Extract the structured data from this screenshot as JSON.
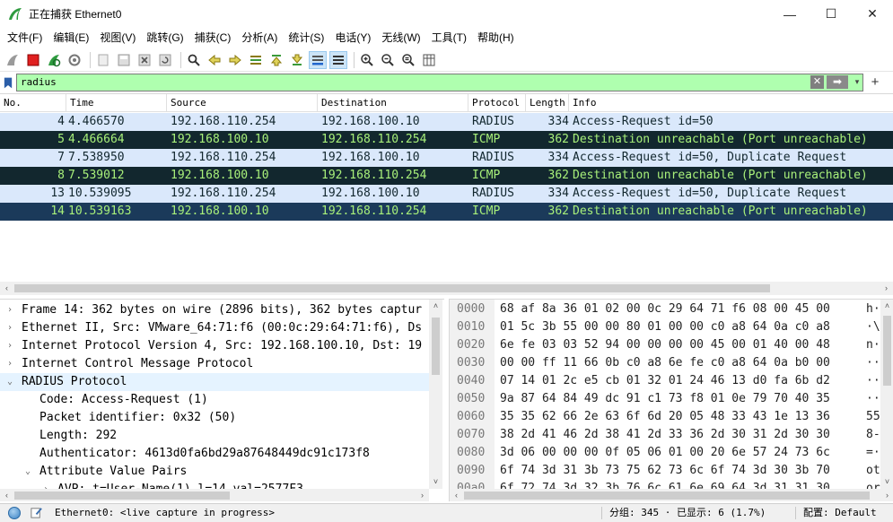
{
  "window": {
    "title": "正在捕获 Ethernet0",
    "minimize": "—",
    "maximize": "☐",
    "close": "✕"
  },
  "menu": [
    "文件(F)",
    "编辑(E)",
    "视图(V)",
    "跳转(G)",
    "捕获(C)",
    "分析(A)",
    "统计(S)",
    "电话(Y)",
    "无线(W)",
    "工具(T)",
    "帮助(H)"
  ],
  "filter": {
    "value": "radius",
    "clear": "✕",
    "apply": "➡",
    "dropdown": "▾",
    "add": "+"
  },
  "packet_list": {
    "columns": [
      "No.",
      "Time",
      "Source",
      "Destination",
      "Protocol",
      "Length",
      "Info"
    ],
    "rows": [
      {
        "no": "4",
        "time": "4.466570",
        "src": "192.168.110.254",
        "dst": "192.168.100.10",
        "proto": "RADIUS",
        "len": "334",
        "info": "Access-Request id=50",
        "kind": "radius"
      },
      {
        "no": "5",
        "time": "4.466664",
        "src": "192.168.100.10",
        "dst": "192.168.110.254",
        "proto": "ICMP",
        "len": "362",
        "info": "Destination unreachable (Port unreachable)",
        "kind": "icmp"
      },
      {
        "no": "7",
        "time": "7.538950",
        "src": "192.168.110.254",
        "dst": "192.168.100.10",
        "proto": "RADIUS",
        "len": "334",
        "info": "Access-Request id=50, Duplicate Request",
        "kind": "radius"
      },
      {
        "no": "8",
        "time": "7.539012",
        "src": "192.168.100.10",
        "dst": "192.168.110.254",
        "proto": "ICMP",
        "len": "362",
        "info": "Destination unreachable (Port unreachable)",
        "kind": "icmp"
      },
      {
        "no": "13",
        "time": "10.539095",
        "src": "192.168.110.254",
        "dst": "192.168.100.10",
        "proto": "RADIUS",
        "len": "334",
        "info": "Access-Request id=50, Duplicate Request",
        "kind": "radius"
      },
      {
        "no": "14",
        "time": "10.539163",
        "src": "192.168.100.10",
        "dst": "192.168.110.254",
        "proto": "ICMP",
        "len": "362",
        "info": "Destination unreachable (Port unreachable)",
        "kind": "selected"
      }
    ]
  },
  "details": [
    {
      "indent": 0,
      "toggle": "›",
      "text": "Frame 14: 362 bytes on wire (2896 bits), 362 bytes captur"
    },
    {
      "indent": 0,
      "toggle": "›",
      "text": "Ethernet II, Src: VMware_64:71:f6 (00:0c:29:64:71:f6), Ds"
    },
    {
      "indent": 0,
      "toggle": "›",
      "text": "Internet Protocol Version 4, Src: 192.168.100.10, Dst: 19"
    },
    {
      "indent": 0,
      "toggle": "›",
      "text": "Internet Control Message Protocol"
    },
    {
      "indent": 0,
      "toggle": "⌄",
      "text": "RADIUS Protocol",
      "selected": true
    },
    {
      "indent": 1,
      "toggle": "",
      "text": "Code: Access-Request (1)"
    },
    {
      "indent": 1,
      "toggle": "",
      "text": "Packet identifier: 0x32 (50)"
    },
    {
      "indent": 1,
      "toggle": "",
      "text": "Length: 292"
    },
    {
      "indent": 1,
      "toggle": "",
      "text": "Authenticator: 4613d0fa6bd29a87648449dc91c173f8"
    },
    {
      "indent": 1,
      "toggle": "⌄",
      "text": "Attribute Value Pairs"
    },
    {
      "indent": 2,
      "toggle": "›",
      "text": "AVP: t=User-Name(1) l=14 val=2577F3"
    }
  ],
  "bytes": [
    {
      "off": "0000",
      "hex": "68 af 8a 36 01 02 00 0c  29 64 71 f6 08 00 45 00",
      "ascii": "h·"
    },
    {
      "off": "0010",
      "hex": "01 5c 3b 55 00 00 80 01  00 00 c0 a8 64 0a c0 a8",
      "ascii": "·\\"
    },
    {
      "off": "0020",
      "hex": "6e fe 03 03 52 94 00 00  00 00 45 00 01 40 00 48",
      "ascii": "n·"
    },
    {
      "off": "0030",
      "hex": "00 00 ff 11 66 0b c0 a8  6e fe c0 a8 64 0a b0 00",
      "ascii": "··"
    },
    {
      "off": "0040",
      "hex": "07 14 01 2c e5 cb 01 32  01 24 46 13 d0 fa 6b d2",
      "ascii": "··"
    },
    {
      "off": "0050",
      "hex": "9a 87 64 84 49 dc 91 c1  73 f8 01 0e 79 70 40 35",
      "ascii": "··"
    },
    {
      "off": "0060",
      "hex": "35 35 62 66 2e 63 6f 6d  20 05 48 33 43 1e 13 36",
      "ascii": "55"
    },
    {
      "off": "0070",
      "hex": "38 2d 41 46 2d 38 41 2d  33 36 2d 30 31 2d 30 30",
      "ascii": "8-"
    },
    {
      "off": "0080",
      "hex": "3d 06 00 00 00 0f 05 06  01 00 20 6e 57 24 73 6c",
      "ascii": "=·"
    },
    {
      "off": "0090",
      "hex": "6f 74 3d 31 3b 73 75 62  73 6c 6f 74 3d 30 3b 70",
      "ascii": "ot"
    },
    {
      "off": "00a0",
      "hex": "6f 72 74 3d 32 3b 76 6c  61 6e 69 64 3d 31 31 30",
      "ascii": "or"
    },
    {
      "off": "00b0",
      "hex": "3a 13 44 16 0a 36 47 71  64 36 ee 00 55 b3 fd a1",
      "ascii": "::"
    }
  ],
  "status": {
    "interface": "Ethernet0: <live capture in progress>",
    "packets": "分组: 345 · 已显示: 6 (1.7%)",
    "profile": "配置: Default"
  },
  "colors": {
    "radius_row": "#dae8fb",
    "icmp_row": "#12272e",
    "icmp_text": "#a8f07a",
    "selected_row": "#1b3a5a",
    "filter_valid": "#afffaf"
  }
}
